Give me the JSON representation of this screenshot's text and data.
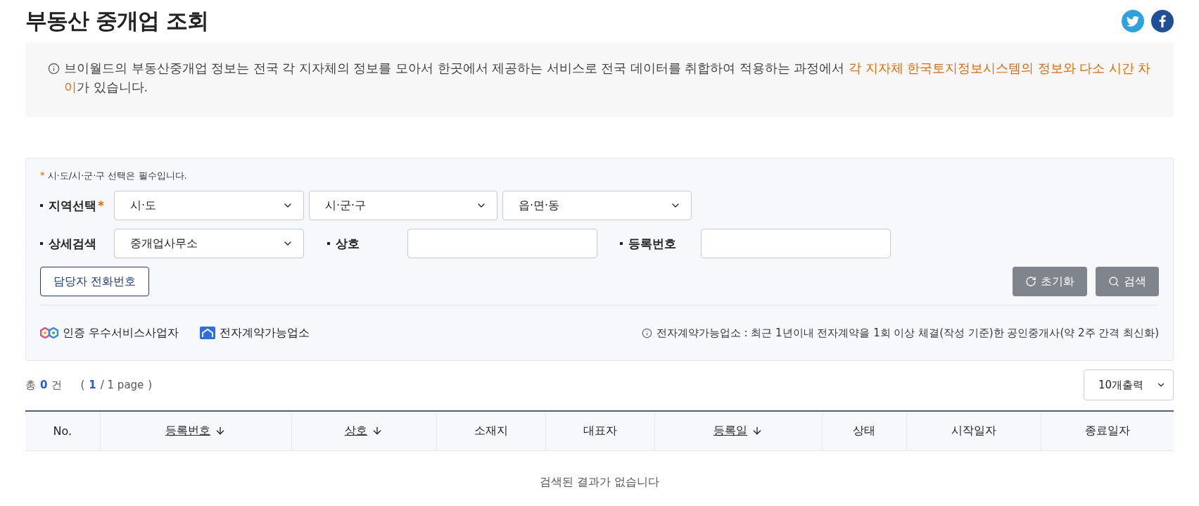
{
  "page_title": "부동산 중개업 조회",
  "share_buttons": [
    {
      "kind": "twitter"
    },
    {
      "kind": "facebook"
    }
  ],
  "notice": {
    "segments": [
      {
        "text": "브이월드의 부동산중개업 정보는 전국 각 지자체의 정보를 모아서 한곳에서 제공하는 서비스로 전국 데이터를 취합하여 적용하는 과정에서 ",
        "emphasis": false
      },
      {
        "text": "각 지자체 한국토지정보시스템의 정보와 다소 시간 차이",
        "emphasis": true
      },
      {
        "text": "가 있습니다.",
        "emphasis": false
      }
    ]
  },
  "filter": {
    "required_mark": "*",
    "required_note": "시·도/시·군·구 선택은 필수입니다.",
    "region": {
      "label": "지역선택",
      "required_mark": "*",
      "selects": [
        "시·도",
        "시·군·구",
        "읍·면·동"
      ]
    },
    "detail": {
      "label": "상세검색",
      "select": "중개업사무소"
    },
    "name": {
      "label": "상호"
    },
    "reg_no": {
      "label": "등록번호"
    },
    "phone_button": "담당자 전화번호",
    "reset_button": "초기화",
    "search_button": "검색",
    "legend": [
      {
        "kind": "certified",
        "text": "인증 우수서비스사업자"
      },
      {
        "kind": "econtract",
        "text": "전자계약가능업소"
      }
    ],
    "legend_note": "전자계약가능업소 : 최근 1년이내 전자계약을 1회 이상 체결(작성 기준)한 공인중개사(약 2주 간격 최신화)"
  },
  "summary": {
    "total_prefix": "총",
    "total": "0",
    "total_suffix": "건",
    "page_open": "(",
    "page": "1",
    "page_rest": "/ 1 page",
    "page_close": ")"
  },
  "page_size": "10개출력",
  "table": {
    "columns": [
      {
        "label": "No.",
        "sortable": false
      },
      {
        "label": "등록번호",
        "sortable": true
      },
      {
        "label": "상호",
        "sortable": true
      },
      {
        "label": "소재지",
        "sortable": false
      },
      {
        "label": "대표자",
        "sortable": false
      },
      {
        "label": "등록일",
        "sortable": true
      },
      {
        "label": "상태",
        "sortable": false
      },
      {
        "label": "시작일자",
        "sortable": false
      },
      {
        "label": "종료일자",
        "sortable": false
      }
    ],
    "empty_message": "검색된 결과가 없습니다"
  }
}
